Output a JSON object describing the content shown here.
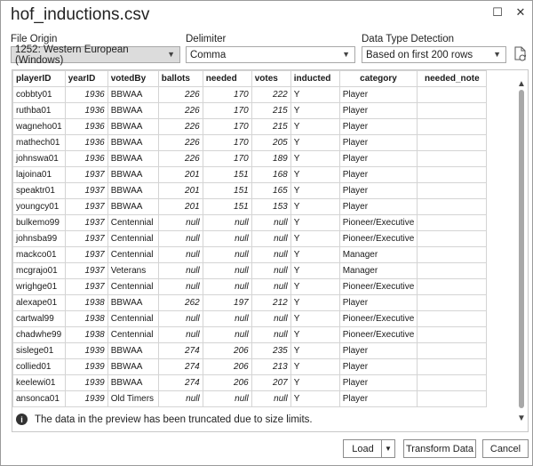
{
  "window": {
    "title": "hof_inductions.csv",
    "restore_icon": "☐",
    "close_icon": "✕"
  },
  "options": {
    "file_origin": {
      "label": "File Origin",
      "value": "1252: Western European (Windows)"
    },
    "delimiter": {
      "label": "Delimiter",
      "value": "Comma"
    },
    "type_detection": {
      "label": "Data Type Detection",
      "value": "Based on first 200 rows"
    }
  },
  "grid": {
    "columns": [
      "playerID",
      "yearID",
      "votedBy",
      "ballots",
      "needed",
      "votes",
      "inducted",
      "category",
      "needed_note"
    ],
    "rows": [
      [
        "cobbty01",
        "1936",
        "BBWAA",
        "226",
        "170",
        "222",
        "Y",
        "Player",
        ""
      ],
      [
        "ruthba01",
        "1936",
        "BBWAA",
        "226",
        "170",
        "215",
        "Y",
        "Player",
        ""
      ],
      [
        "wagneho01",
        "1936",
        "BBWAA",
        "226",
        "170",
        "215",
        "Y",
        "Player",
        ""
      ],
      [
        "mathech01",
        "1936",
        "BBWAA",
        "226",
        "170",
        "205",
        "Y",
        "Player",
        ""
      ],
      [
        "johnswa01",
        "1936",
        "BBWAA",
        "226",
        "170",
        "189",
        "Y",
        "Player",
        ""
      ],
      [
        "lajoina01",
        "1937",
        "BBWAA",
        "201",
        "151",
        "168",
        "Y",
        "Player",
        ""
      ],
      [
        "speaktr01",
        "1937",
        "BBWAA",
        "201",
        "151",
        "165",
        "Y",
        "Player",
        ""
      ],
      [
        "youngcy01",
        "1937",
        "BBWAA",
        "201",
        "151",
        "153",
        "Y",
        "Player",
        ""
      ],
      [
        "bulkemo99",
        "1937",
        "Centennial",
        "null",
        "null",
        "null",
        "Y",
        "Pioneer/Executive",
        ""
      ],
      [
        "johnsba99",
        "1937",
        "Centennial",
        "null",
        "null",
        "null",
        "Y",
        "Pioneer/Executive",
        ""
      ],
      [
        "mackco01",
        "1937",
        "Centennial",
        "null",
        "null",
        "null",
        "Y",
        "Manager",
        ""
      ],
      [
        "mcgrajo01",
        "1937",
        "Veterans",
        "null",
        "null",
        "null",
        "Y",
        "Manager",
        ""
      ],
      [
        "wrighge01",
        "1937",
        "Centennial",
        "null",
        "null",
        "null",
        "Y",
        "Pioneer/Executive",
        ""
      ],
      [
        "alexape01",
        "1938",
        "BBWAA",
        "262",
        "197",
        "212",
        "Y",
        "Player",
        ""
      ],
      [
        "cartwal99",
        "1938",
        "Centennial",
        "null",
        "null",
        "null",
        "Y",
        "Pioneer/Executive",
        ""
      ],
      [
        "chadwhe99",
        "1938",
        "Centennial",
        "null",
        "null",
        "null",
        "Y",
        "Pioneer/Executive",
        ""
      ],
      [
        "sislege01",
        "1939",
        "BBWAA",
        "274",
        "206",
        "235",
        "Y",
        "Player",
        ""
      ],
      [
        "collied01",
        "1939",
        "BBWAA",
        "274",
        "206",
        "213",
        "Y",
        "Player",
        ""
      ],
      [
        "keelewi01",
        "1939",
        "BBWAA",
        "274",
        "206",
        "207",
        "Y",
        "Player",
        ""
      ],
      [
        "ansonca01",
        "1939",
        "Old Timers",
        "null",
        "null",
        "null",
        "Y",
        "Player",
        ""
      ]
    ]
  },
  "notice": "The data in the preview has been truncated due to size limits.",
  "buttons": {
    "load": "Load",
    "transform": "Transform Data",
    "cancel": "Cancel"
  }
}
